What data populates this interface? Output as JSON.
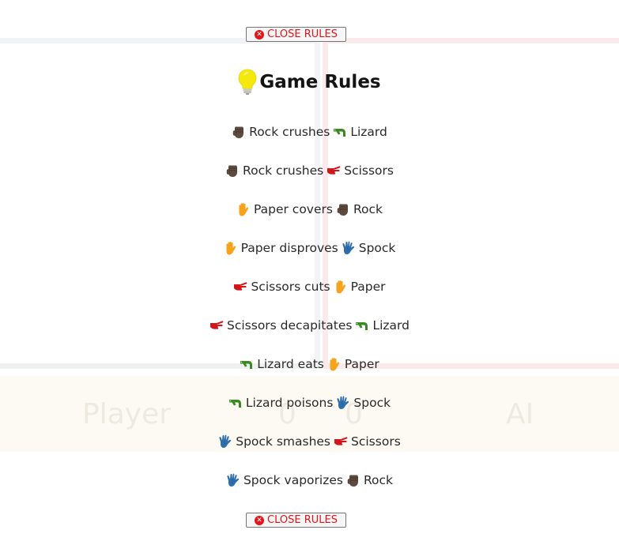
{
  "close_button": {
    "label": "CLOSE RULES",
    "icon": "close-circle-icon"
  },
  "title": {
    "text": "Game Rules",
    "icon": "lightbulb-icon"
  },
  "rules": [
    {
      "left_icon": "rock-icon",
      "text_left": "Rock crushes",
      "right_icon": "lizard-icon",
      "text_right": "Lizard"
    },
    {
      "left_icon": "rock-icon",
      "text_left": "Rock crushes",
      "right_icon": "scissors-icon",
      "text_right": "Scissors"
    },
    {
      "left_icon": "paper-icon",
      "text_left": "Paper covers",
      "right_icon": "rock-icon",
      "text_right": "Rock"
    },
    {
      "left_icon": "paper-icon",
      "text_left": "Paper disproves",
      "right_icon": "spock-icon",
      "text_right": "Spock"
    },
    {
      "left_icon": "scissors-icon",
      "text_left": "Scissors cuts",
      "right_icon": "paper-icon",
      "text_right": "Paper"
    },
    {
      "left_icon": "scissors-icon",
      "text_left": "Scissors decapitates",
      "right_icon": "lizard-icon",
      "text_right": "Lizard"
    },
    {
      "left_icon": "lizard-icon",
      "text_left": "Lizard eats",
      "right_icon": "paper-icon",
      "text_right": "Paper"
    },
    {
      "left_icon": "lizard-icon",
      "text_left": "Lizard poisons",
      "right_icon": "spock-icon",
      "text_right": "Spock"
    },
    {
      "left_icon": "spock-icon",
      "text_left": "Spock smashes",
      "right_icon": "scissors-icon",
      "text_right": "Scissors"
    },
    {
      "left_icon": "spock-icon",
      "text_left": "Spock vaporizes",
      "right_icon": "rock-icon",
      "text_right": "Rock"
    }
  ],
  "scoreboard": {
    "player_label": "Player",
    "player_score": "0",
    "ai_score": "0",
    "ai_label": "AI"
  },
  "colors": {
    "close_red": "#e0161b",
    "rock": "#5e4b3f",
    "paper": "#f7a21b",
    "scissors": "#d2151a",
    "lizard": "#3b8a1f",
    "spock": "#2f6fad",
    "bulb": "#f5e80c"
  }
}
